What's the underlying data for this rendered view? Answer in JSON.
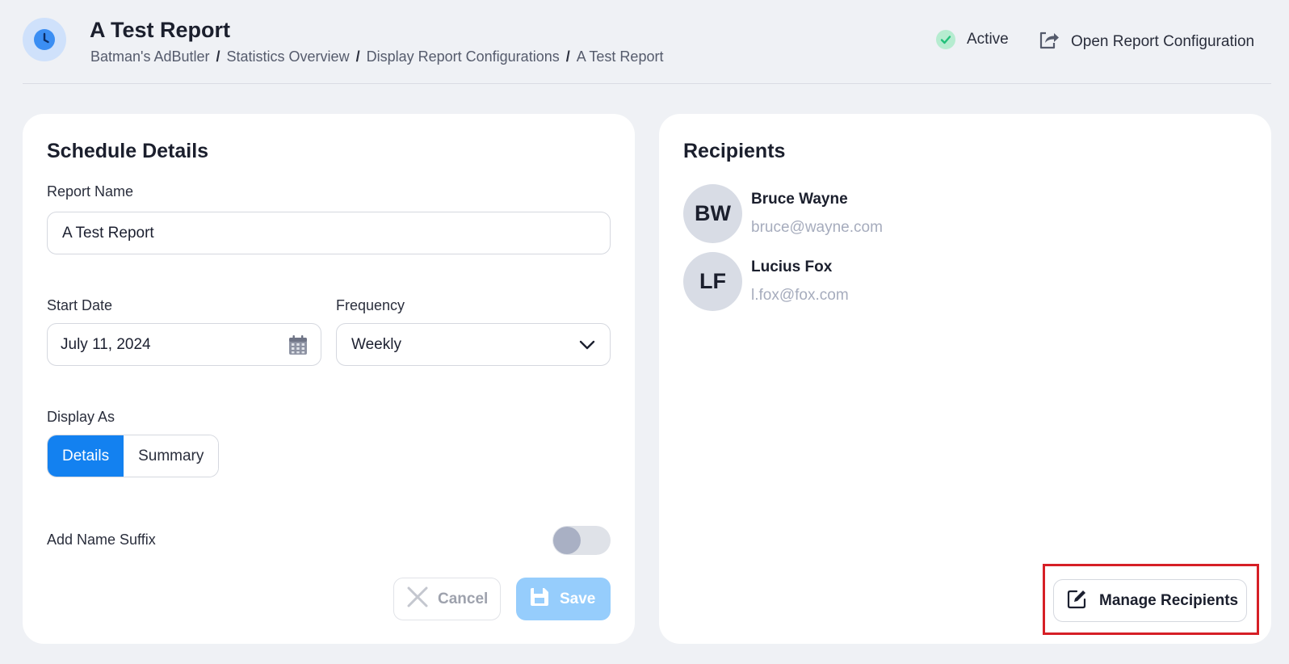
{
  "header": {
    "title": "A Test Report",
    "breadcrumb": [
      "Batman's AdButler",
      "Statistics Overview",
      "Display Report Configurations",
      "A Test Report"
    ],
    "breadcrumb_separator": "/",
    "status_label": "Active",
    "open_config_label": "Open Report Configuration"
  },
  "schedule": {
    "title": "Schedule Details",
    "report_name_label": "Report Name",
    "report_name_value": "A Test Report",
    "start_date_label": "Start Date",
    "start_date_value": "July 11, 2024",
    "frequency_label": "Frequency",
    "frequency_value": "Weekly",
    "display_as_label": "Display As",
    "display_as_options": [
      "Details",
      "Summary"
    ],
    "display_as_selected": "Details",
    "name_suffix_label": "Add Name Suffix",
    "name_suffix_enabled": false,
    "cancel_label": "Cancel",
    "save_label": "Save"
  },
  "recipients": {
    "title": "Recipients",
    "list": [
      {
        "initials": "BW",
        "name": "Bruce Wayne",
        "email": "bruce@wayne.com"
      },
      {
        "initials": "LF",
        "name": "Lucius Fox",
        "email": "l.fox@fox.com"
      }
    ],
    "manage_label": "Manage Recipients"
  },
  "colors": {
    "accent": "#1381f0",
    "save_disabled": "#96cdfc",
    "active_status": "#b6ecd0",
    "highlight": "#d61f26"
  },
  "icons": {
    "header_badge": "clock-icon",
    "status": "check-icon",
    "open_config": "share-icon",
    "date": "calendar-icon",
    "frequency": "chevron-down-icon",
    "cancel": "close-icon",
    "save": "floppy-disk-icon",
    "manage": "edit-icon"
  }
}
